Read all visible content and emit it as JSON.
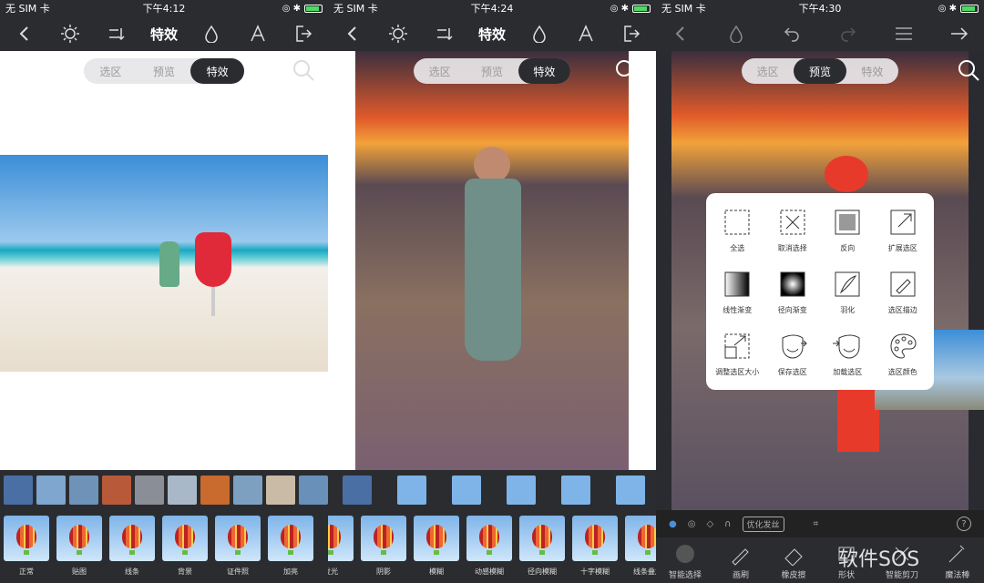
{
  "panels": [
    {
      "carrier": "无 SIM 卡",
      "time": "下午4:12",
      "title": "特效"
    },
    {
      "carrier": "无 SIM 卡",
      "time": "下午4:24",
      "title": "特效"
    },
    {
      "carrier": "无 SIM 卡",
      "time": "下午4:30",
      "title": ""
    }
  ],
  "segment": {
    "select": "选区",
    "preview": "预览",
    "effects": "特效"
  },
  "effects_p1": [
    "正常",
    "贴图",
    "线条",
    "背景",
    "证件照",
    "加亮"
  ],
  "effects_p2": [
    "发光",
    "阴影",
    "模糊",
    "动感模糊",
    "径向模糊",
    "十字模糊",
    "线条叠加"
  ],
  "menu": [
    "全选",
    "取消选择",
    "反向",
    "扩展选区",
    "线性渐变",
    "径向渐变",
    "羽化",
    "选区描边",
    "调整选区大小",
    "保存选区",
    "加载选区",
    "选区颜色"
  ],
  "p3_tools": [
    "智能选择",
    "画刷",
    "橡皮擦",
    "形状",
    "智能剪刀",
    "魔法棒"
  ],
  "optimize_label": "优化发丝",
  "watermark": "软件SOS",
  "colors": {
    "bar": "#2b2c30",
    "accent": "#ffffff"
  }
}
